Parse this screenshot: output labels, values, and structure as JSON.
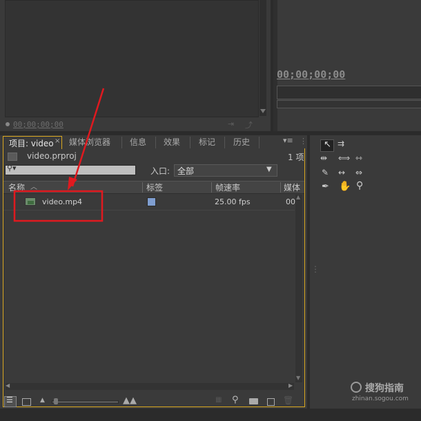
{
  "source_monitor": {
    "timecode": "00;00;00;00"
  },
  "program_monitor": {
    "timecode": "00;00;00;00"
  },
  "project_panel": {
    "tabs": [
      "项目: video",
      "媒体浏览器",
      "信息",
      "效果",
      "标记",
      "历史"
    ],
    "project_file": "video.prproj",
    "item_count": "1 项",
    "search_placeholder": "",
    "in_label": "入口:",
    "in_select_value": "全部",
    "columns": [
      "名称",
      "标签",
      "帧速率",
      "媒体"
    ],
    "rows": [
      {
        "name": "video.mp4",
        "label_color": "#7f9ed0",
        "frame_rate": "25.00 fps",
        "media": "00"
      }
    ]
  },
  "tools_panel": {
    "tools": [
      "selection-tool",
      "track-select-tool",
      "ripple-edit-tool",
      "rolling-edit-tool",
      "rate-stretch-tool",
      "razor-tool",
      "slip-tool",
      "slide-tool",
      "pen-tool",
      "hand-tool",
      "zoom-tool"
    ]
  },
  "watermark": {
    "brand": "搜狗指南",
    "url": "zhinan.sogou.com"
  },
  "annotation": {
    "color": "#e0191f"
  }
}
